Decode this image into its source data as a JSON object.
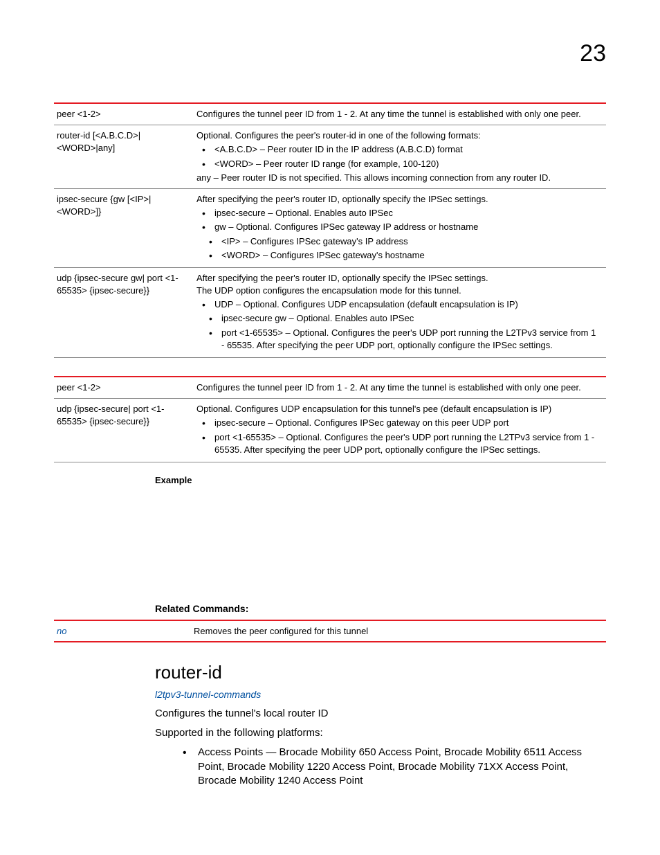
{
  "page_number": "23",
  "table1": {
    "rows": [
      {
        "param": "peer <1-2>",
        "desc_plain": "Configures the tunnel peer ID from 1 - 2. At any time the tunnel is established with only one peer."
      },
      {
        "param": "router-id [<A.B.C.D>|<WORD>|any]",
        "desc_intro": "Optional. Configures the peer's router-id in one of the following formats:",
        "bullets": [
          "<A.B.C.D> – Peer router ID in the IP address (A.B.C.D) format",
          "<WORD> – Peer router ID range (for example, 100-120)"
        ],
        "desc_after": "any – Peer router ID is not specified. This allows incoming connection from any router ID."
      },
      {
        "param": "ipsec-secure {gw [<IP>|<WORD>]}",
        "desc_intro": "After specifying the peer's router ID, optionally specify the IPSec settings.",
        "bullets": [
          "ipsec-secure – Optional. Enables auto IPSec",
          "gw – Optional. Configures IPSec gateway IP address or hostname"
        ],
        "nested_bullets": [
          "<IP> – Configures IPSec gateway's IP address",
          "<WORD> – Configures IPSec gateway's hostname"
        ]
      },
      {
        "param": "udp {ipsec-secure gw| port <1-65535> {ipsec-secure}}",
        "desc_intro": "After specifying the peer's router ID, optionally specify the IPSec settings.",
        "desc_intro2": "The UDP option configures the encapsulation mode for this tunnel.",
        "bullets": [
          "UDP – Optional. Configures UDP encapsulation (default encapsulation is IP)"
        ],
        "nested_bullets": [
          "ipsec-secure gw – Optional. Enables auto IPSec",
          "port <1-65535> – Optional. Configures the peer's UDP port running the L2TPv3 service from 1 - 65535. After specifying the peer UDP port, optionally configure the IPSec settings."
        ]
      }
    ]
  },
  "table2": {
    "rows": [
      {
        "param": "peer <1-2>",
        "desc_plain": "Configures the tunnel peer ID from 1 - 2. At any time the tunnel is established with only one peer."
      },
      {
        "param": "udp {ipsec-secure| port <1-65535> {ipsec-secure}}",
        "desc_intro": "Optional. Configures UDP encapsulation for this tunnel's pee (default encapsulation is IP)",
        "bullets": [
          "ipsec-secure – Optional. Configures IPSec gateway on this peer UDP port",
          "port <1-65535> – Optional. Configures the peer's UDP port running the L2TPv3 service from 1 - 65535. After specifying the peer UDP port, optionally configure the IPSec settings."
        ]
      }
    ]
  },
  "example_label": "Example",
  "related_label": "Related Commands:",
  "related_table": {
    "cmd": "no",
    "desc": "Removes the peer configured for this tunnel"
  },
  "heading": "router-id",
  "link": "l2tpv3-tunnel-commands",
  "body1": "Configures the tunnel's local router ID",
  "body2": "Supported in the following platforms:",
  "platforms": "Access Points — Brocade Mobility 650 Access Point, Brocade Mobility 6511 Access Point, Brocade Mobility 1220 Access Point, Brocade Mobility 71XX Access Point, Brocade Mobility 1240 Access Point"
}
